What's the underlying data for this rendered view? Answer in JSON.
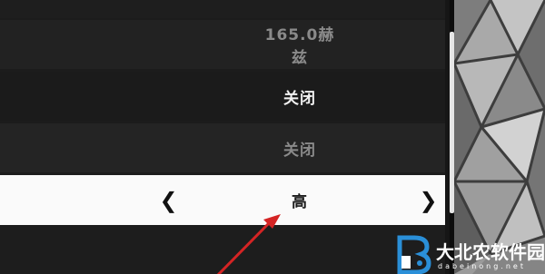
{
  "settings": {
    "rows": [
      {
        "value": "165.0赫兹"
      },
      {
        "value": "关闭"
      },
      {
        "value": "关闭"
      },
      {
        "value": "高"
      }
    ]
  },
  "watermark": {
    "text": "大北农软件园",
    "domain": "dabeinong.net"
  },
  "colors": {
    "selected_row_bg": "#fafafa",
    "annotation_arrow": "#d42424",
    "panel_bg": "#1c1c1c"
  },
  "icons": {
    "left_arrow": "chevron-left-icon",
    "right_arrow": "chevron-right-icon"
  }
}
